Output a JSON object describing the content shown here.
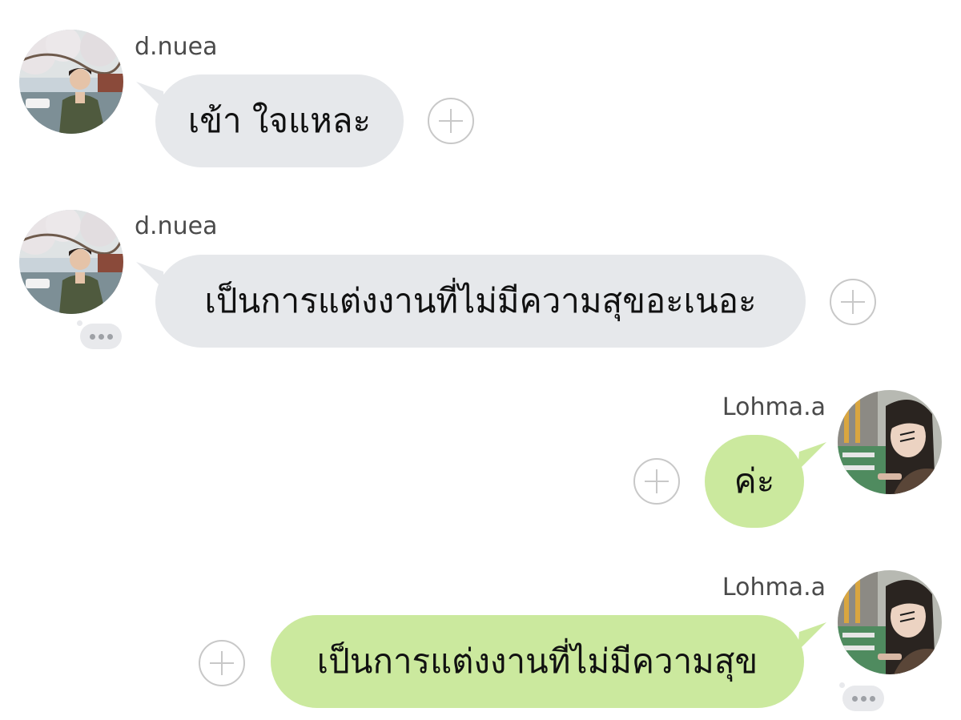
{
  "messages": [
    {
      "sender": "d.nuea",
      "text": "เข้า ใจแหละ",
      "side": "incoming",
      "avatar": "avatar-d-nuea"
    },
    {
      "sender": "d.nuea",
      "text": "เป็นการแต่งงานที่ไม่มีความสุขอะเนอะ",
      "side": "incoming",
      "avatar": "avatar-d-nuea"
    },
    {
      "sender": "Lohma.a",
      "text": "ค่ะ",
      "side": "outgoing",
      "avatar": "avatar-lohma-a"
    },
    {
      "sender": "Lohma.a",
      "text": "เป็นการแต่งงานที่ไม่มีความสุข",
      "side": "outgoing",
      "avatar": "avatar-lohma-a"
    }
  ],
  "colors": {
    "incoming_bubble": "#e6e8eb",
    "outgoing_bubble": "#cbe99e",
    "sender_text": "#4a4a4a",
    "message_text": "#111111",
    "plus_icon": "#c8c8c8"
  },
  "icons": {
    "add_reaction": "plus-circle-icon",
    "more_options": "more-dots-icon"
  }
}
